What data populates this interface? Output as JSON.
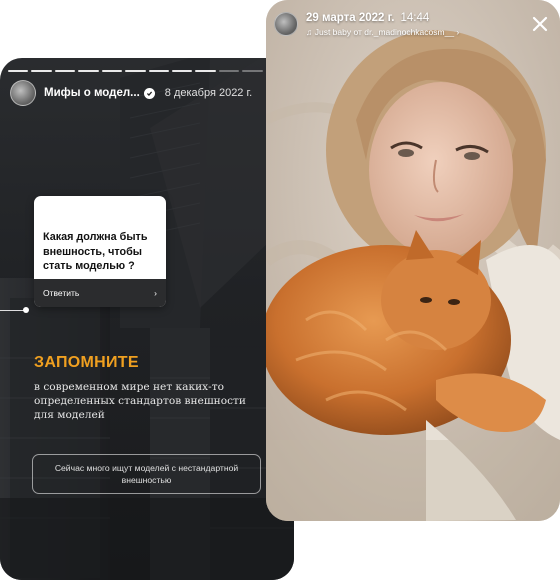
{
  "left_story": {
    "account_name": "Мифы о модел...",
    "date": "8 декабря 2022 г.",
    "more_icon": "more-dots-icon",
    "question": {
      "text": "Какая должна быть внешность, чтобы стать моделью ?",
      "reply_label": "Ответить",
      "chevron": "›"
    },
    "remember_title": "ЗАПОМНИТЕ",
    "remember_text": "в современном мире нет каких-то определенных стандартов внешности для моделей",
    "note": "Сейчас много ищут моделей с нестандартной внешностью",
    "accent_color": "#f0a020"
  },
  "right_story": {
    "date": "29 марта 2022 г.",
    "time": "14:44",
    "music": "♫ Just baby от dr._madinochkacosm__ ›",
    "close_icon": "close-icon"
  }
}
